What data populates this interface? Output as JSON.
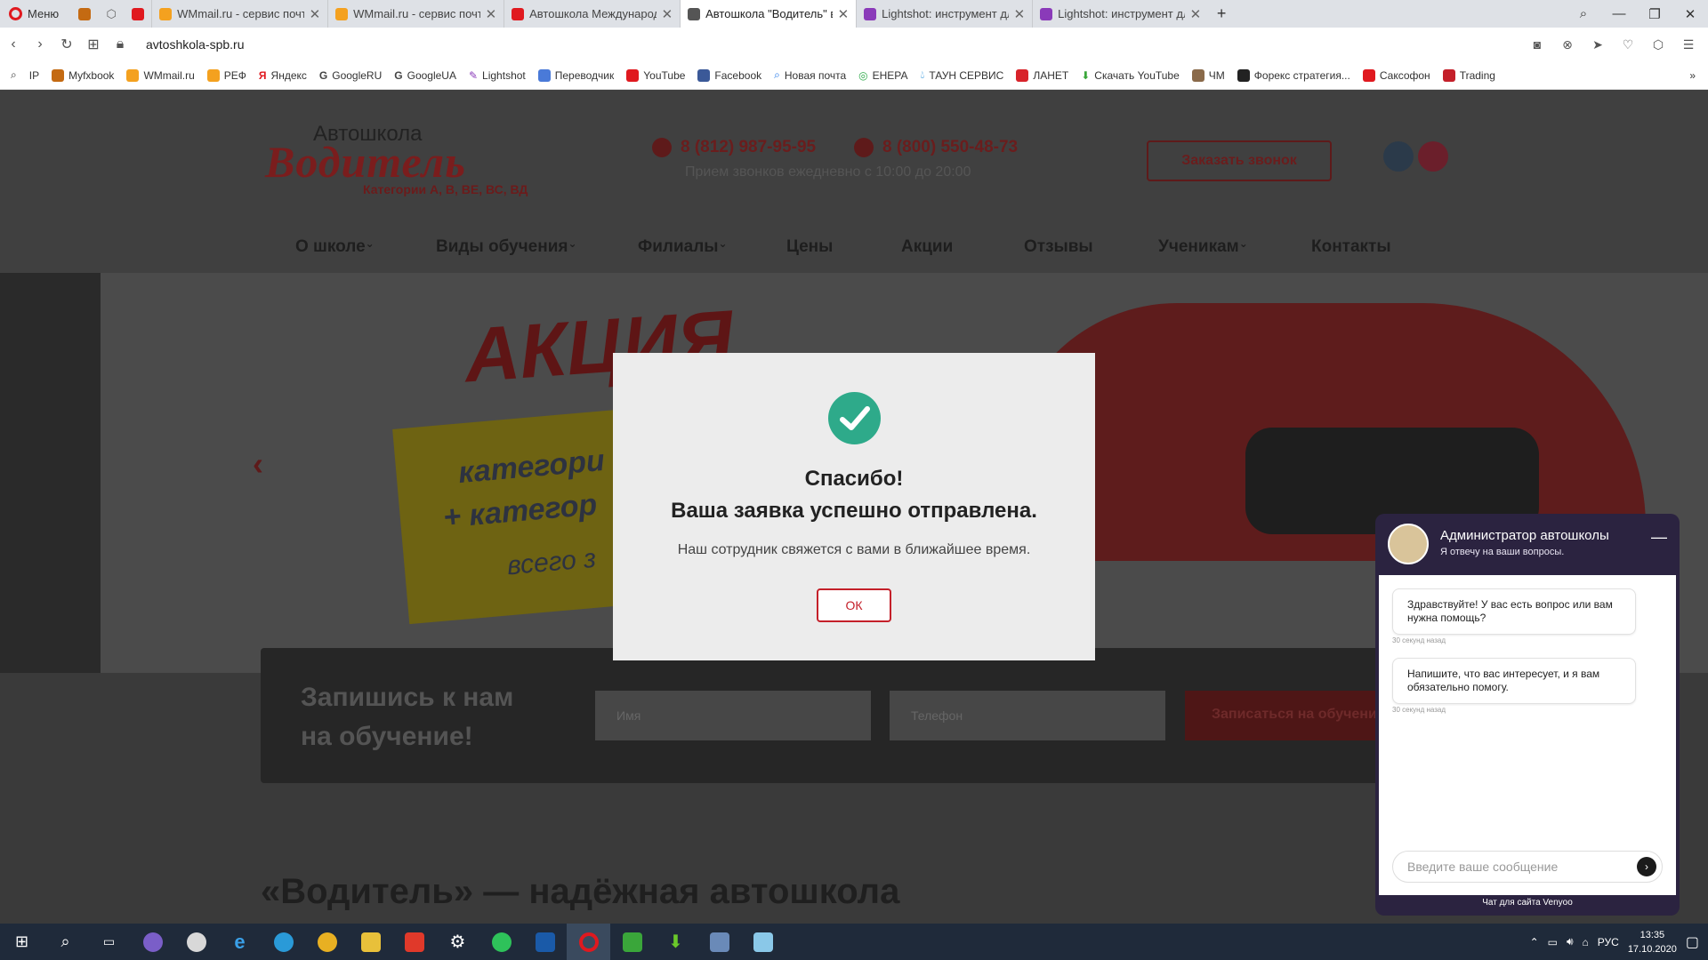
{
  "browser": {
    "menu_label": "Меню",
    "tabs": [
      {
        "title": "WMmail.ru - сервис почто",
        "active": false,
        "fav_color": "#f4a11f"
      },
      {
        "title": "WMmail.ru - сервис почто",
        "active": false,
        "fav_color": "#f4a11f"
      },
      {
        "title": "Автошкола Международн",
        "active": false,
        "fav_color": "#e0191f"
      },
      {
        "title": "Автошкола \"Водитель\" в С",
        "active": true,
        "fav_color": "#555555"
      },
      {
        "title": "Lightshot: инструмент для",
        "active": false,
        "fav_color": "#8a3ab9"
      },
      {
        "title": "Lightshot: инструмент для",
        "active": false,
        "fav_color": "#8a3ab9"
      }
    ],
    "new_tab": "+",
    "url": "avtoshkola-spb.ru",
    "bookmarks": [
      "IP",
      "Myfxbook",
      "WMmail.ru",
      "РЕФ",
      "Яндекс",
      "GoogleRU",
      "GoogleUA",
      "Lightshot",
      "Переводчик",
      "YouTube",
      "Facebook",
      "Новая почта",
      "ЕНЕРА",
      "ТАУН СЕРВИС",
      "ЛАНЕТ",
      "Скачать YouTube",
      "ЧМ",
      "Форекс стратегия...",
      "Саксофон",
      "Trading"
    ]
  },
  "site": {
    "logo_small": "Автошкола",
    "logo_big": "Водитель",
    "logo_categories": "Категории А, В, ВЕ, ВС, ВД",
    "phone1": "8 (812) 987-95-95",
    "phone2": "8 (800) 550-48-73",
    "hours": "Прием звонков ежедневно с 10:00 до 20:00",
    "callback_button": "Заказать звонок",
    "menu": [
      "О школе",
      "Виды обучения",
      "Филиалы",
      "Цены",
      "Акции",
      "Отзывы",
      "Ученикам",
      "Контакты"
    ],
    "hero": {
      "promo": "АКЦИЯ",
      "line1": "категори",
      "line2": "+ категор",
      "line3": "всего з"
    },
    "signup": {
      "title_line1": "Запишись к нам",
      "title_line2": "на обучение!",
      "name_placeholder": "Имя",
      "phone_placeholder": "Телефон",
      "button": "Записаться на обучение"
    },
    "headline": "«Водитель» — надёжная автошкола"
  },
  "modal": {
    "title1": "Спасибо!",
    "title2": "Ваша заявка успешно отправлена.",
    "text": "Наш сотрудник свяжется с вами в ближайшее время.",
    "ok_label": "ОК"
  },
  "chat": {
    "name": "Администратор автошколы",
    "subtitle": "Я отвечу на ваши вопросы.",
    "messages": [
      {
        "text": "Здравствуйте! У вас есть вопрос или вам нужна помощь?",
        "time": "30 секунд назад"
      },
      {
        "text": "Напишите, что вас интересует, и я вам обязательно помогу.",
        "time": "30 секунд назад"
      }
    ],
    "input_placeholder": "Введите ваше сообщение",
    "footer": "Чат для сайта Venyoo"
  },
  "taskbar": {
    "language": "РУС",
    "time": "13:35",
    "date": "17.10.2020"
  }
}
